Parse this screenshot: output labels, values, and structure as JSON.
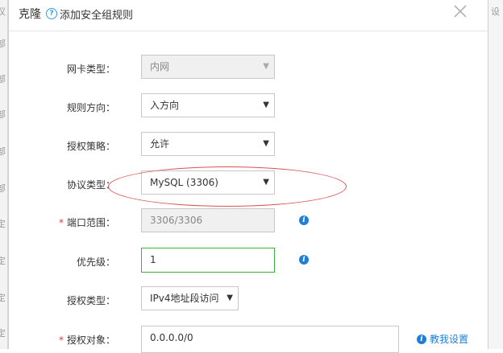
{
  "background": {
    "left_fragments": [
      "议",
      "部",
      "部",
      "部",
      "部",
      "部",
      "定",
      "定",
      "定",
      "定"
    ],
    "right_fragment": "设"
  },
  "modal": {
    "title": "克隆",
    "subtitle": "添加安全组规则",
    "help_icon": "question-circle-icon",
    "close_icon": "close-x-icon"
  },
  "form": {
    "nic_type": {
      "label": "网卡类型：",
      "value": "内网",
      "disabled": true
    },
    "rule_direction": {
      "label": "规则方向：",
      "value": "入方向"
    },
    "auth_policy": {
      "label": "授权策略：",
      "value": "允许"
    },
    "protocol_type": {
      "label": "协议类型：",
      "value": "MySQL (3306)"
    },
    "port_range": {
      "label": "端口范围：",
      "required": true,
      "value": "3306/3306",
      "disabled": true
    },
    "priority": {
      "label": "优先级：",
      "value": "1"
    },
    "auth_type": {
      "label": "授权类型：",
      "value": "IPv4地址段访问"
    },
    "auth_object": {
      "label": "授权对象：",
      "required": true,
      "value": "0.0.0.0/0"
    }
  },
  "help_link": {
    "label": "教我设置",
    "icon": "info-icon"
  },
  "colors": {
    "accent": "#1f7fd6",
    "required": "#e4393c",
    "focus_border": "#3bb33b",
    "highlight": "#d9534f"
  }
}
